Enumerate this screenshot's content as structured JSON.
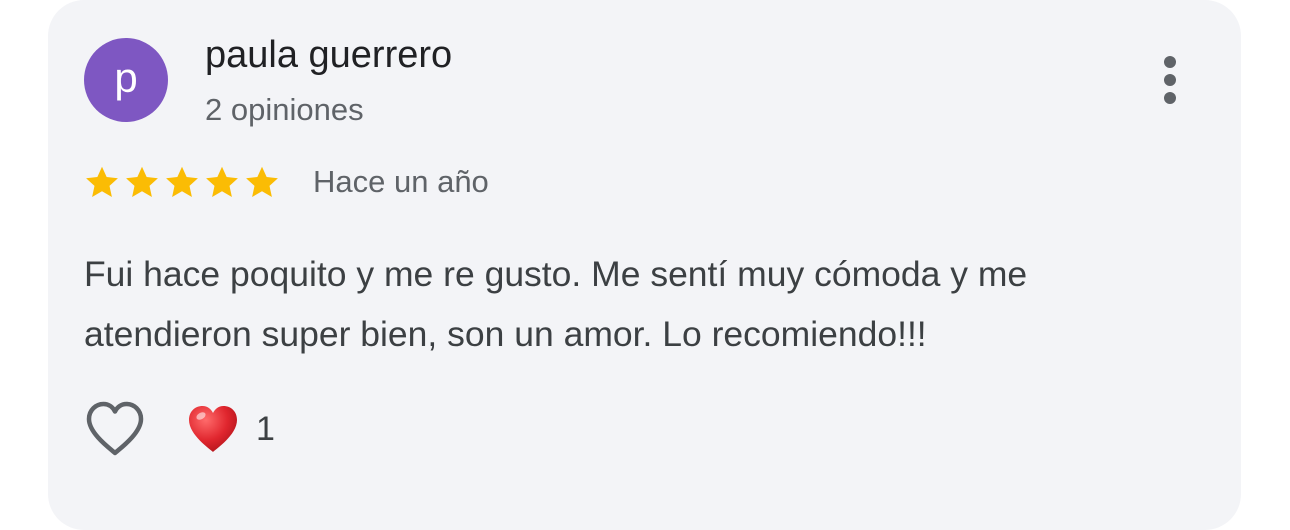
{
  "reviewer": {
    "avatar_letter": "p",
    "avatar_color": "#7e57c2",
    "name": "paula guerrero",
    "review_count": "2 opiniones"
  },
  "rating": {
    "stars": 5,
    "max_stars": 5,
    "star_color": "#fbbc04"
  },
  "date": "Hace un año",
  "review_text": "Fui hace poquito y me re gusto. Me sentí muy cómoda y me atendieron super bien, son un amor. Lo recomiendo!!!",
  "reactions": {
    "like_icon": "heart-outline-icon",
    "reaction_icon": "red-heart-icon",
    "reaction_color": "#e0262e",
    "count": "1"
  },
  "menu_icon": "more-vertical-icon"
}
